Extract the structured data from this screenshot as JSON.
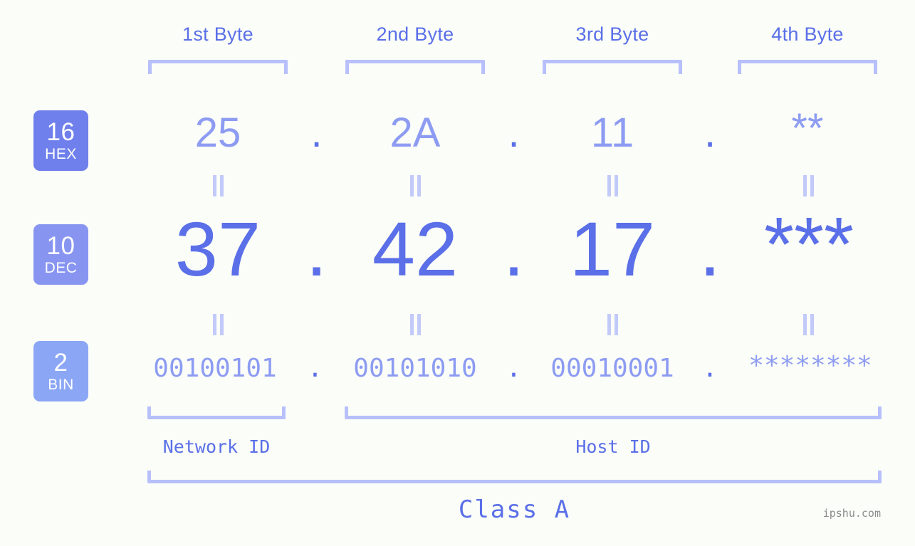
{
  "background_color": "#fbfdf8",
  "accent_color": "#5a6fe8",
  "accent_light_color": "#8d9cf2",
  "bracket_color": "#b7c0fb",
  "byte_headers": [
    {
      "label": "1st Byte"
    },
    {
      "label": "2nd Byte"
    },
    {
      "label": "3rd Byte"
    },
    {
      "label": "4th Byte"
    }
  ],
  "bases": [
    {
      "num": "16",
      "abbr": "HEX",
      "color": "#6f80ec"
    },
    {
      "num": "10",
      "abbr": "DEC",
      "color": "#8795f1"
    },
    {
      "num": "2",
      "abbr": "BIN",
      "color": "#8aa6f5"
    }
  ],
  "rows": {
    "hex": {
      "values": [
        "25",
        "2A",
        "11",
        "**"
      ],
      "separator": "."
    },
    "dec": {
      "values": [
        "37",
        "42",
        "17",
        "***"
      ],
      "separator": "."
    },
    "bin": {
      "values": [
        "00100101",
        "00101010",
        "00010001",
        "********"
      ],
      "separator": "."
    }
  },
  "equals_symbol": "=",
  "sections": [
    {
      "label": "Network ID"
    },
    {
      "label": "Host ID"
    }
  ],
  "class_label": "Class A",
  "watermark": "ipshu.com"
}
